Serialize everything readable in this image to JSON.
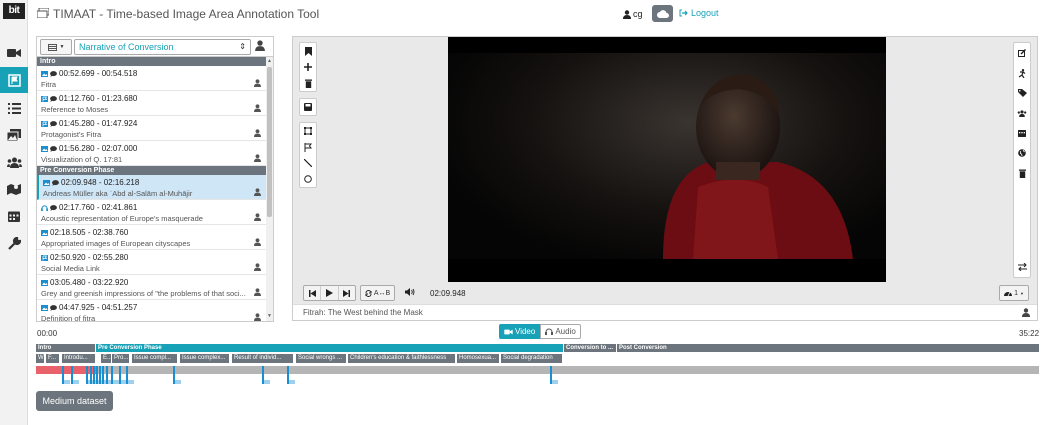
{
  "app": {
    "logo": "bit",
    "title": "TIMAAT - Time-based Image Area Annotation Tool",
    "user": "cg",
    "logout": "Logout"
  },
  "nav": [
    "video-camera-icon",
    "annotation-icon",
    "list-icon",
    "images-icon",
    "users-icon",
    "map-icon",
    "calendar-icon",
    "wrench-icon"
  ],
  "list": {
    "analysis_select": "Narrative of Conversion",
    "segments": [
      {
        "name": "Intro",
        "items": [
          {
            "time": "00:52.699 - 00:54.518",
            "title": "Fitra",
            "icons": [
              "image",
              "comment"
            ]
          },
          {
            "time": "01:12.760 - 01:23.680",
            "title": "Reference to Moses",
            "icons": [
              "flag",
              "comment"
            ]
          },
          {
            "time": "01:45.280 - 01:47.924",
            "title": "Protagonist's Fitra",
            "icons": [
              "flag",
              "comment"
            ]
          },
          {
            "time": "01:56.280 - 02:07.000",
            "title": "Visualization of Q. 17:81",
            "icons": [
              "image",
              "comment"
            ]
          }
        ]
      },
      {
        "name": "Pre Conversion Phase",
        "items": [
          {
            "time": "02:09.948 - 02:16.218",
            "title": "Andreas Müller aka ʿAbd al-Salām al-Muhājir",
            "icons": [
              "image",
              "comment"
            ],
            "selected": true
          },
          {
            "time": "02:17.760 - 02:41.861",
            "title": "Acoustic representation of Europe's masquerade",
            "icons": [
              "audio",
              "comment"
            ]
          },
          {
            "time": "02:18.505 - 02:38.760",
            "title": "Appropriated images of European cityscapes",
            "icons": [
              "image"
            ]
          },
          {
            "time": "02:50.920 - 02:55.280",
            "title": "Social Media Link",
            "icons": [
              "flag"
            ]
          },
          {
            "time": "03:05.480 - 03:22.920",
            "title": "Grey and greenish impressions of \"the problems of that soci...",
            "icons": [
              "image"
            ]
          },
          {
            "time": "04:47.925 - 04:51.257",
            "title": "Definition of fitra",
            "icons": [
              "image",
              "comment"
            ]
          }
        ]
      }
    ]
  },
  "player": {
    "time": "02:09.948",
    "loop_label": "A↔B",
    "speed": "1",
    "medium_title": "Fitrah: The West behind the Mask"
  },
  "timeline": {
    "start": "00:00",
    "end": "35:22",
    "tab_video": "Video",
    "tab_audio": "Audio",
    "categories": [
      "Intro",
      "Pre Conversion Phase",
      "Conversion to ...",
      "Post Conversion"
    ],
    "subsegments": [
      "W",
      "F...",
      "Introdu...",
      "E...",
      "Pro...",
      "Issue compl...",
      "Issue complex...",
      "Result of individ...",
      "Social wrongs ...",
      "Children's education & faithlessness",
      "Homosexua...",
      "Social degradation"
    ]
  },
  "footer": {
    "dataset_button": "Medium dataset"
  },
  "colors": {
    "accent": "#17a2b8",
    "segment": "#6c757d",
    "played": "#e8616b",
    "marker": "#1a8fcf"
  }
}
